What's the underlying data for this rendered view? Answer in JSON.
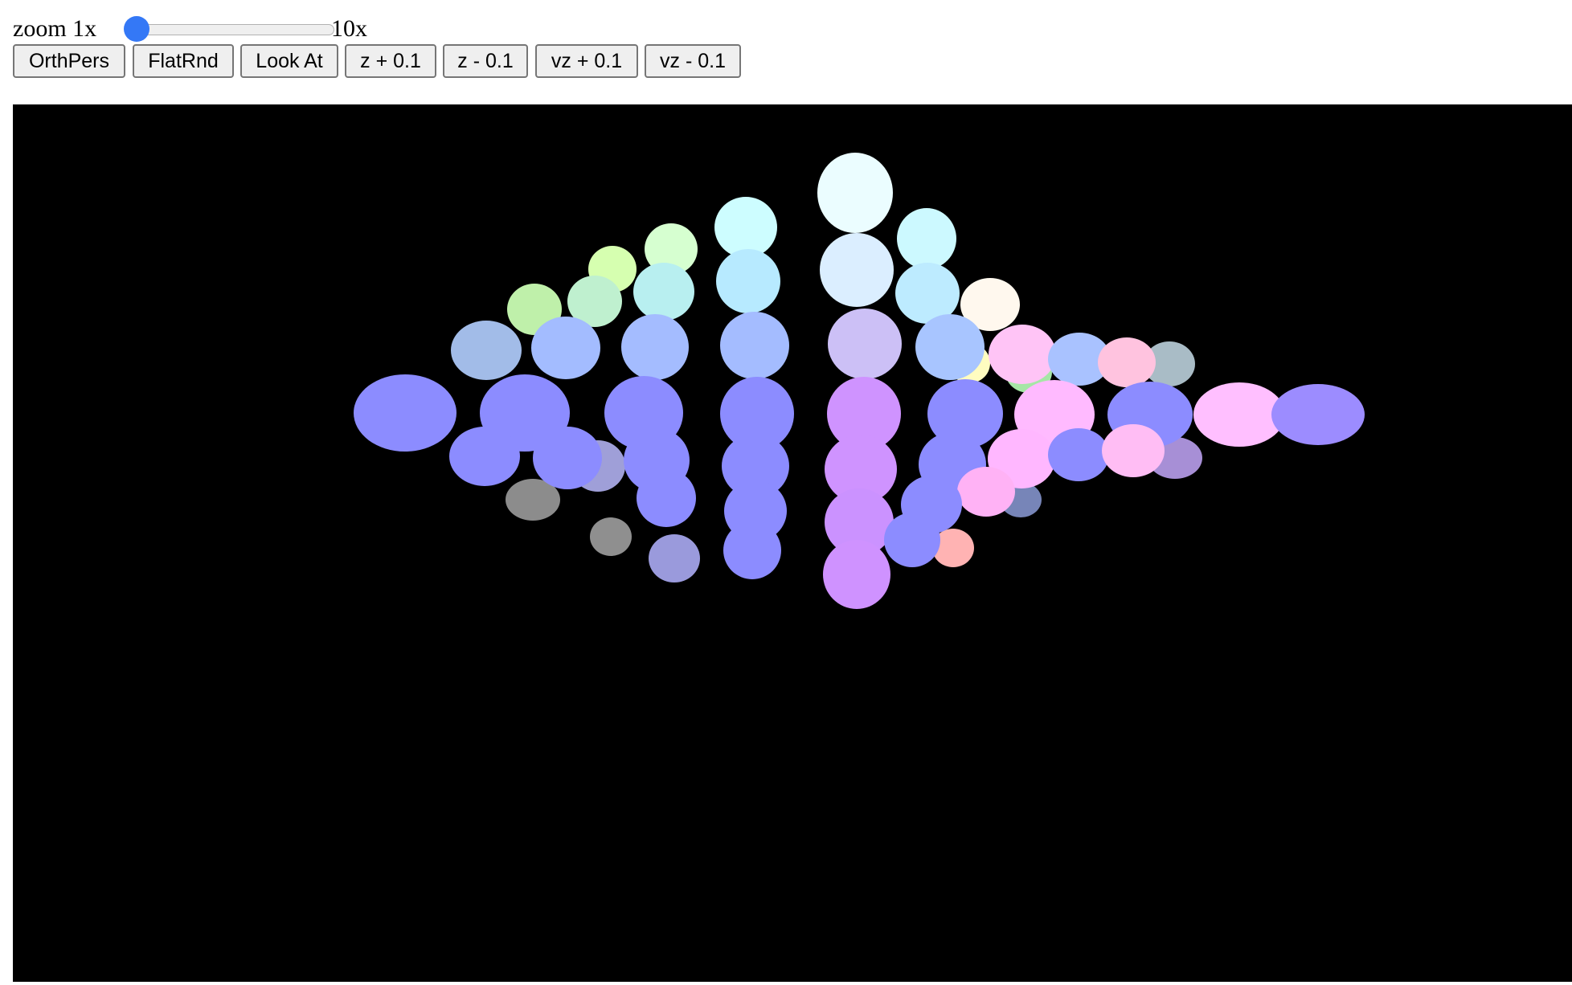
{
  "zoom": {
    "label_min": "zoom 1x",
    "label_max": "10x",
    "value": 1,
    "min": 1,
    "max": 10
  },
  "buttons": {
    "orthpers": "OrthPers",
    "flatrnd": "FlatRnd",
    "lookat": "Look At",
    "z_plus": "z + 0.1",
    "z_minus": "z - 0.1",
    "vz_plus": "vz + 0.1",
    "vz_minus": "vz - 0.1"
  },
  "colors": {
    "canvas_background": "#000000",
    "slider_thumb": "#3478f6"
  }
}
